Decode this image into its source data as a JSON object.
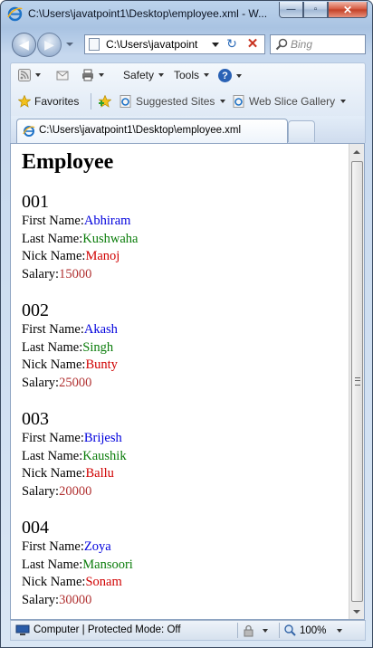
{
  "window": {
    "title": "C:\\Users\\javatpoint1\\Desktop\\employee.xml - W...",
    "minimize_symbol": "—",
    "maximize_symbol": "▫",
    "close_symbol": "✕"
  },
  "address": {
    "value": "C:\\Users\\javatpoint",
    "refresh_symbol": "↻",
    "stop_symbol": "✕"
  },
  "search": {
    "placeholder": "Bing"
  },
  "commandbar": {
    "safety_label": "Safety",
    "tools_label": "Tools",
    "help_symbol": "?"
  },
  "favorites": {
    "favorites_label": "Favorites",
    "suggested_sites_label": "Suggested Sites",
    "web_slice_gallery_label": "Web Slice Gallery"
  },
  "tab": {
    "label": "C:\\Users\\javatpoint1\\Desktop\\employee.xml"
  },
  "document": {
    "heading": "Employee",
    "first_name_label": "First Name:",
    "last_name_label": "Last Name:",
    "nick_name_label": "Nick Name:",
    "salary_label": "Salary:",
    "employees": [
      {
        "id": "001",
        "first_name": "Abhiram",
        "last_name": "Kushwaha",
        "nick_name": "Manoj",
        "salary": "15000"
      },
      {
        "id": "002",
        "first_name": "Akash",
        "last_name": "Singh",
        "nick_name": "Bunty",
        "salary": "25000"
      },
      {
        "id": "003",
        "first_name": "Brijesh",
        "last_name": "Kaushik",
        "nick_name": "Ballu",
        "salary": "20000"
      },
      {
        "id": "004",
        "first_name": "Zoya",
        "last_name": "Mansoori",
        "nick_name": "Sonam",
        "salary": "30000"
      }
    ]
  },
  "statusbar": {
    "zone_text": "Computer | Protected Mode: Off",
    "zoom": "100%"
  },
  "colors": {
    "first_name": "#0000dd",
    "last_name": "#0b7d0b",
    "nick_name": "#d00000",
    "salary": "#b03030"
  }
}
